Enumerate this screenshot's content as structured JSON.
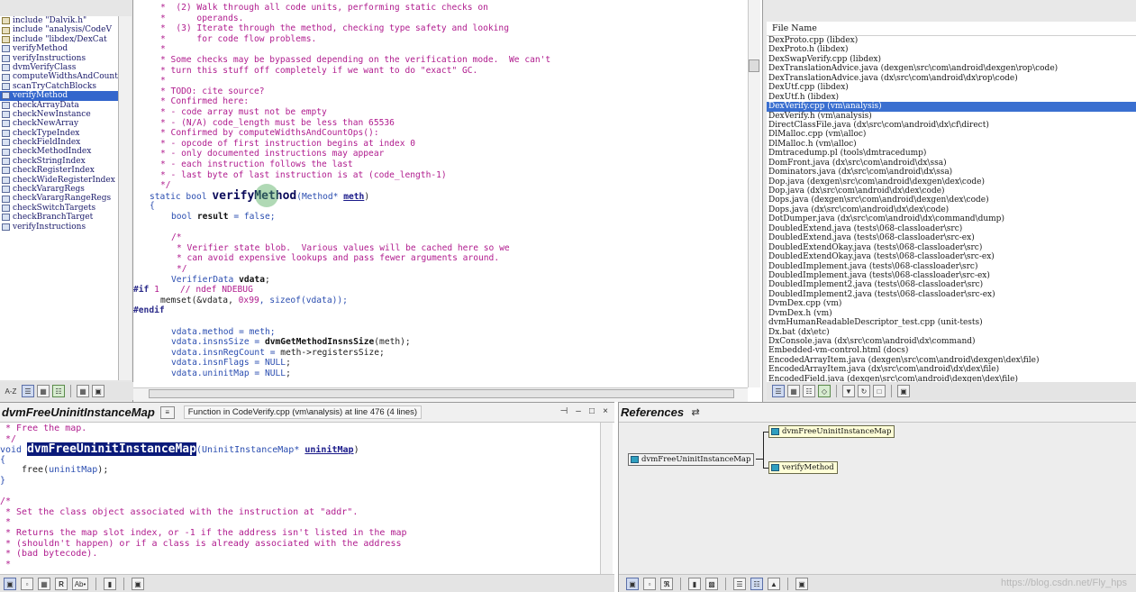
{
  "symbol_window": {
    "items": [
      {
        "label": "include \"Dalvik.h\"",
        "kind": "include"
      },
      {
        "label": "include \"analysis/CodeV",
        "kind": "include"
      },
      {
        "label": "include \"libdex/DexCat",
        "kind": "include"
      },
      {
        "label": "verifyMethod",
        "kind": "function"
      },
      {
        "label": "verifyInstructions",
        "kind": "function"
      },
      {
        "label": "dvmVerifyClass",
        "kind": "function"
      },
      {
        "label": "computeWidthsAndCountOp",
        "kind": "function"
      },
      {
        "label": "scanTryCatchBlocks",
        "kind": "function"
      },
      {
        "label": "verifyMethod",
        "kind": "function",
        "selected": true
      },
      {
        "label": "checkArrayData",
        "kind": "function"
      },
      {
        "label": "checkNewInstance",
        "kind": "function"
      },
      {
        "label": "checkNewArray",
        "kind": "function"
      },
      {
        "label": "checkTypeIndex",
        "kind": "function"
      },
      {
        "label": "checkFieldIndex",
        "kind": "function"
      },
      {
        "label": "checkMethodIndex",
        "kind": "function"
      },
      {
        "label": "checkStringIndex",
        "kind": "function"
      },
      {
        "label": "checkRegisterIndex",
        "kind": "function"
      },
      {
        "label": "checkWideRegisterIndex",
        "kind": "function"
      },
      {
        "label": "checkVarargRegs",
        "kind": "function"
      },
      {
        "label": "checkVarargRangeRegs",
        "kind": "function"
      },
      {
        "label": "checkSwitchTargets",
        "kind": "function"
      },
      {
        "label": "checkBranchTarget",
        "kind": "function"
      },
      {
        "label": "verifyInstructions",
        "kind": "function"
      }
    ],
    "toolbar": {
      "sort_label": "A-Z"
    }
  },
  "editor": {
    "lines": [
      {
        "indent": 5,
        "parts": [
          {
            "t": "*  (2) Walk through all code units, performing static checks on",
            "c": "cm"
          }
        ]
      },
      {
        "indent": 5,
        "parts": [
          {
            "t": "*      operands.",
            "c": "cm"
          }
        ]
      },
      {
        "indent": 5,
        "parts": [
          {
            "t": "*  (3) Iterate through the method, checking type safety and looking",
            "c": "cm"
          }
        ]
      },
      {
        "indent": 5,
        "parts": [
          {
            "t": "*      for code flow problems.",
            "c": "cm"
          }
        ]
      },
      {
        "indent": 5,
        "parts": [
          {
            "t": "*",
            "c": "cm"
          }
        ]
      },
      {
        "indent": 5,
        "parts": [
          {
            "t": "* Some checks may be bypassed depending on the verification mode.  We can't",
            "c": "cm"
          }
        ]
      },
      {
        "indent": 5,
        "parts": [
          {
            "t": "* turn this stuff off completely if we want to do \"exact\" GC.",
            "c": "cm"
          }
        ]
      },
      {
        "indent": 5,
        "parts": [
          {
            "t": "*",
            "c": "cm"
          }
        ]
      },
      {
        "indent": 5,
        "parts": [
          {
            "t": "* TODO: cite source?",
            "c": "cm"
          }
        ]
      },
      {
        "indent": 5,
        "parts": [
          {
            "t": "* Confirmed here:",
            "c": "cm"
          }
        ]
      },
      {
        "indent": 5,
        "parts": [
          {
            "t": "* - code array must not be empty",
            "c": "cm"
          }
        ]
      },
      {
        "indent": 5,
        "parts": [
          {
            "t": "* - (N/A) code_length must be less than 65536",
            "c": "cm"
          }
        ]
      },
      {
        "indent": 5,
        "parts": [
          {
            "t": "* Confirmed by computeWidthsAndCountOps():",
            "c": "cm"
          }
        ]
      },
      {
        "indent": 5,
        "parts": [
          {
            "t": "* - opcode of first instruction begins at index 0",
            "c": "cm"
          }
        ]
      },
      {
        "indent": 5,
        "parts": [
          {
            "t": "* - only documented instructions may appear",
            "c": "cm"
          }
        ]
      },
      {
        "indent": 5,
        "parts": [
          {
            "t": "* - each instruction follows the last",
            "c": "cm"
          }
        ]
      },
      {
        "indent": 5,
        "parts": [
          {
            "t": "* - last byte of last instruction is at (code_length-1)",
            "c": "cm"
          }
        ]
      },
      {
        "indent": 5,
        "parts": [
          {
            "t": "*/",
            "c": "cm"
          }
        ]
      },
      {
        "indent": 3,
        "parts": [
          {
            "t": "static bool ",
            "c": "kw"
          },
          {
            "t": "verifyMethod",
            "c": "fn-def"
          },
          {
            "t": "(Method* ",
            "c": "kw"
          },
          {
            "t": "meth",
            "c": "param"
          },
          {
            "t": ")",
            "c": ""
          }
        ]
      },
      {
        "indent": 3,
        "parts": [
          {
            "t": "{",
            "c": "kw"
          }
        ]
      },
      {
        "indent": 7,
        "parts": [
          {
            "t": "bool ",
            "c": "kw"
          },
          {
            "t": "result",
            "c": "bold"
          },
          {
            "t": " = false;",
            "c": "kw"
          }
        ]
      },
      {
        "indent": 7,
        "parts": [
          {
            "t": "",
            "c": ""
          }
        ]
      },
      {
        "indent": 7,
        "parts": [
          {
            "t": "/*",
            "c": "cm"
          }
        ]
      },
      {
        "indent": 8,
        "parts": [
          {
            "t": "* Verifier state blob.  Various values will be cached here so we",
            "c": "cm"
          }
        ]
      },
      {
        "indent": 8,
        "parts": [
          {
            "t": "* can avoid expensive lookups and pass fewer arguments around.",
            "c": "cm"
          }
        ]
      },
      {
        "indent": 8,
        "parts": [
          {
            "t": "*/",
            "c": "cm"
          }
        ]
      },
      {
        "indent": 7,
        "parts": [
          {
            "t": "VerifierData ",
            "c": "kw"
          },
          {
            "t": "vdata",
            "c": "bold"
          },
          {
            "t": ";",
            "c": ""
          }
        ]
      },
      {
        "indent": 0,
        "parts": [
          {
            "t": "#if ",
            "c": "pp"
          },
          {
            "t": "1",
            "c": "num"
          },
          {
            "t": "    // ndef NDEBUG",
            "c": "cm"
          }
        ]
      },
      {
        "indent": 5,
        "parts": [
          {
            "t": "memset(&vdata, ",
            "c": ""
          },
          {
            "t": "0x99",
            "c": "num"
          },
          {
            "t": ", sizeof(vdata));",
            "c": "kw"
          }
        ]
      },
      {
        "indent": 0,
        "parts": [
          {
            "t": "#endif",
            "c": "pp"
          }
        ]
      },
      {
        "indent": 0,
        "parts": [
          {
            "t": "",
            "c": ""
          }
        ]
      },
      {
        "indent": 7,
        "parts": [
          {
            "t": "vdata.method = meth;",
            "c": "kw"
          }
        ]
      },
      {
        "indent": 7,
        "parts": [
          {
            "t": "vdata.insnsSize = ",
            "c": "kw"
          },
          {
            "t": "dvmGetMethodInsnsSize",
            "c": "bold"
          },
          {
            "t": "(meth);",
            "c": ""
          }
        ]
      },
      {
        "indent": 7,
        "parts": [
          {
            "t": "vdata.insnRegCount = ",
            "c": "kw"
          },
          {
            "t": "meth->registersSize;",
            "c": ""
          }
        ]
      },
      {
        "indent": 7,
        "parts": [
          {
            "t": "vdata.insnFlags = ",
            "c": "kw"
          },
          {
            "t": "NULL",
            "c": "macro"
          },
          {
            "t": ";",
            "c": ""
          }
        ]
      },
      {
        "indent": 7,
        "parts": [
          {
            "t": "vdata.uninitMap = ",
            "c": "kw"
          },
          {
            "t": "NULL",
            "c": "macro"
          },
          {
            "t": ";",
            "c": ""
          }
        ]
      }
    ]
  },
  "file_window": {
    "header": "File Name",
    "files": [
      "DexProto.cpp (libdex)",
      "DexProto.h (libdex)",
      "DexSwapVerify.cpp (libdex)",
      "DexTranslationAdvice.java (dexgen\\src\\com\\android\\dexgen\\rop\\code)",
      "DexTranslationAdvice.java (dx\\src\\com\\android\\dx\\rop\\code)",
      "DexUtf.cpp (libdex)",
      "DexUtf.h (libdex)",
      "DexVerify.cpp (vm\\analysis)",
      "DexVerify.h (vm\\analysis)",
      "DirectClassFile.java (dx\\src\\com\\android\\dx\\cf\\direct)",
      "DlMalloc.cpp (vm\\alloc)",
      "DlMalloc.h (vm\\alloc)",
      "Dmtracedump.pl (tools\\dmtracedump)",
      "DomFront.java (dx\\src\\com\\android\\dx\\ssa)",
      "Dominators.java (dx\\src\\com\\android\\dx\\ssa)",
      "Dop.java (dexgen\\src\\com\\android\\dexgen\\dex\\code)",
      "Dop.java (dx\\src\\com\\android\\dx\\dex\\code)",
      "Dops.java (dexgen\\src\\com\\android\\dexgen\\dex\\code)",
      "Dops.java (dx\\src\\com\\android\\dx\\dex\\code)",
      "DotDumper.java (dx\\src\\com\\android\\dx\\command\\dump)",
      "DoubledExtend.java (tests\\068-classloader\\src)",
      "DoubledExtend.java (tests\\068-classloader\\src-ex)",
      "DoubledExtendOkay.java (tests\\068-classloader\\src)",
      "DoubledExtendOkay.java (tests\\068-classloader\\src-ex)",
      "DoubledImplement.java (tests\\068-classloader\\src)",
      "DoubledImplement.java (tests\\068-classloader\\src-ex)",
      "DoubledImplement2.java (tests\\068-classloader\\src)",
      "DoubledImplement2.java (tests\\068-classloader\\src-ex)",
      "DvmDex.cpp (vm)",
      "DvmDex.h (vm)",
      "dvmHumanReadableDescriptor_test.cpp (unit-tests)",
      "Dx.bat (dx\\etc)",
      "DxConsole.java (dx\\src\\com\\android\\dx\\command)",
      "Embedded-vm-control.html (docs)",
      "EncodedArrayItem.java (dexgen\\src\\com\\android\\dexgen\\dex\\file)",
      "EncodedArrayItem.java (dx\\src\\com\\android\\dx\\dex\\file)",
      "EncodedField.java (dexgen\\src\\com\\android\\dexgen\\dex\\file)"
    ],
    "selected_index": 7
  },
  "context_window": {
    "title": "dvmFreeUninitInstanceMap",
    "info": "Function in CodeVerify.cpp (vm\\analysis) at line 476 (4 lines)",
    "win_buttons": {
      "pin": "⊣",
      "minimize": "–",
      "maximize": "□",
      "close": "×"
    },
    "lines": [
      {
        "indent": 1,
        "parts": [
          {
            "t": "* Free the map.",
            "c": "cm"
          }
        ]
      },
      {
        "indent": 1,
        "parts": [
          {
            "t": "*/",
            "c": "cm"
          }
        ]
      },
      {
        "indent": 0,
        "parts": [
          {
            "t": "void ",
            "c": "kw"
          },
          {
            "t": "dvmFreeUninitInstanceMap",
            "c": "hl"
          },
          {
            "t": "(UninitInstanceMap* ",
            "c": "kw"
          },
          {
            "t": "uninitMap",
            "c": "param"
          },
          {
            "t": ")",
            "c": ""
          }
        ]
      },
      {
        "indent": 0,
        "parts": [
          {
            "t": "{",
            "c": "kw"
          }
        ]
      },
      {
        "indent": 4,
        "parts": [
          {
            "t": "free(",
            "c": ""
          },
          {
            "t": "uninitMap",
            "c": "kw"
          },
          {
            "t": ");",
            "c": ""
          }
        ]
      },
      {
        "indent": 0,
        "parts": [
          {
            "t": "}",
            "c": "kw"
          }
        ]
      },
      {
        "indent": 0,
        "parts": [
          {
            "t": "",
            "c": ""
          }
        ]
      },
      {
        "indent": 0,
        "parts": [
          {
            "t": "/*",
            "c": "cm"
          }
        ]
      },
      {
        "indent": 1,
        "parts": [
          {
            "t": "* Set the class object associated with the instruction at \"addr\".",
            "c": "cm"
          }
        ]
      },
      {
        "indent": 1,
        "parts": [
          {
            "t": "*",
            "c": "cm"
          }
        ]
      },
      {
        "indent": 1,
        "parts": [
          {
            "t": "* Returns the map slot index, or -1 if the address isn't listed in the map",
            "c": "cm"
          }
        ]
      },
      {
        "indent": 1,
        "parts": [
          {
            "t": "* (shouldn't happen) or if a class is already associated with the address",
            "c": "cm"
          }
        ]
      },
      {
        "indent": 1,
        "parts": [
          {
            "t": "* (bad bytecode).",
            "c": "cm"
          }
        ]
      },
      {
        "indent": 1,
        "parts": [
          {
            "t": "*",
            "c": "cm"
          }
        ]
      }
    ],
    "toolbar_labels": {
      "ref": "R",
      "abc": "Ab•"
    }
  },
  "relation_window": {
    "title": "References",
    "root": "dvmFreeUninitInstanceMap",
    "children": [
      "dvmFreeUninitInstanceMap",
      "verifyMethod"
    ],
    "watermark": "https://blog.csdn.net/Fly_hps"
  }
}
